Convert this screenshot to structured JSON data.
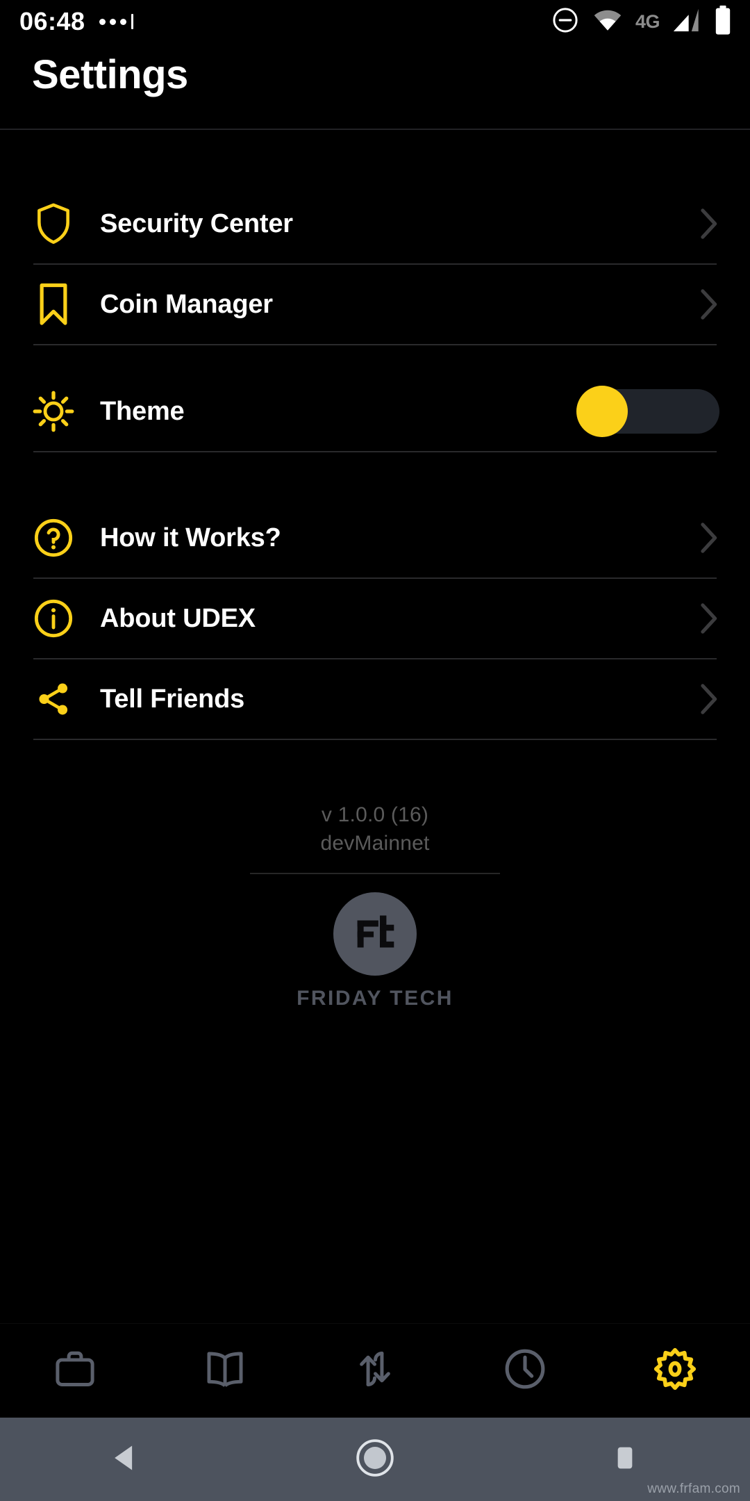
{
  "statusbar": {
    "time": "06:48",
    "notification_dots_icon": "three-dots-icon",
    "dnd_icon": "do-not-disturb-icon",
    "wifi_icon": "wifi-icon",
    "network_label": "4G",
    "signal_icon": "cellular-signal-icon",
    "battery_icon": "battery-full-icon"
  },
  "header": {
    "title": "Settings"
  },
  "groups": [
    {
      "items": [
        {
          "label": "Security Center",
          "icon": "shield-icon",
          "accessory": "chevron-right-icon"
        },
        {
          "label": "Coin Manager",
          "icon": "bookmark-icon",
          "accessory": "chevron-right-icon"
        }
      ]
    },
    {
      "items": [
        {
          "label": "Theme",
          "icon": "sun-icon",
          "accessory": "toggle-switch",
          "toggle_on": false
        }
      ]
    },
    {
      "items": [
        {
          "label": "How it Works?",
          "icon": "question-circle-icon",
          "accessory": "chevron-right-icon"
        },
        {
          "label": "About UDEX",
          "icon": "info-circle-icon",
          "accessory": "chevron-right-icon"
        },
        {
          "label": "Tell Friends",
          "icon": "share-icon",
          "accessory": "chevron-right-icon"
        }
      ]
    }
  ],
  "footer": {
    "version": "v 1.0.0 (16)",
    "environment": "devMainnet",
    "logo_mark": "Ft",
    "brand": "FRIDAY TECH"
  },
  "tabbar": {
    "tabs": [
      {
        "name": "wallet",
        "icon": "briefcase-icon",
        "active": false
      },
      {
        "name": "book",
        "icon": "open-book-icon",
        "active": false
      },
      {
        "name": "swap",
        "icon": "swap-arrows-icon",
        "active": false
      },
      {
        "name": "history",
        "icon": "clock-icon",
        "active": false
      },
      {
        "name": "settings",
        "icon": "gear-icon",
        "active": true
      }
    ]
  },
  "navbar": {
    "back_icon": "back-triangle-icon",
    "home_icon": "home-circle-icon",
    "recents_icon": "recents-square-icon",
    "watermark": "www.frfam.com"
  },
  "colors": {
    "accent": "#FBD019",
    "background": "#000000",
    "text": "#FFFFFF",
    "muted": "#5B5B5B",
    "tab_inactive": "#5A5F6B",
    "navbar": "#4D535E"
  }
}
